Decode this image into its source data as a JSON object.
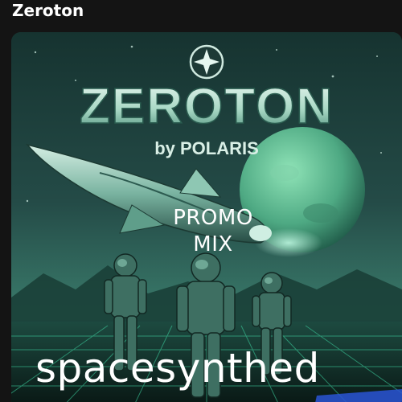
{
  "header": {
    "title": "Zeroton"
  },
  "cover": {
    "logo_text": "ZEROTON",
    "byline": "by POLARIS",
    "overlay_line": "PROMO\nMIX",
    "artist": "spacesynthed",
    "emblem_icon": "compass-star-icon"
  },
  "colors": {
    "page_bg": "#141414",
    "sky_top": "#173532",
    "sky_mid": "#2c5a55",
    "horizon_glow": "#4fa98c",
    "planet": "#56b98f",
    "grid_line": "#3fd7a4",
    "logo_fill": "#b9ded2"
  }
}
